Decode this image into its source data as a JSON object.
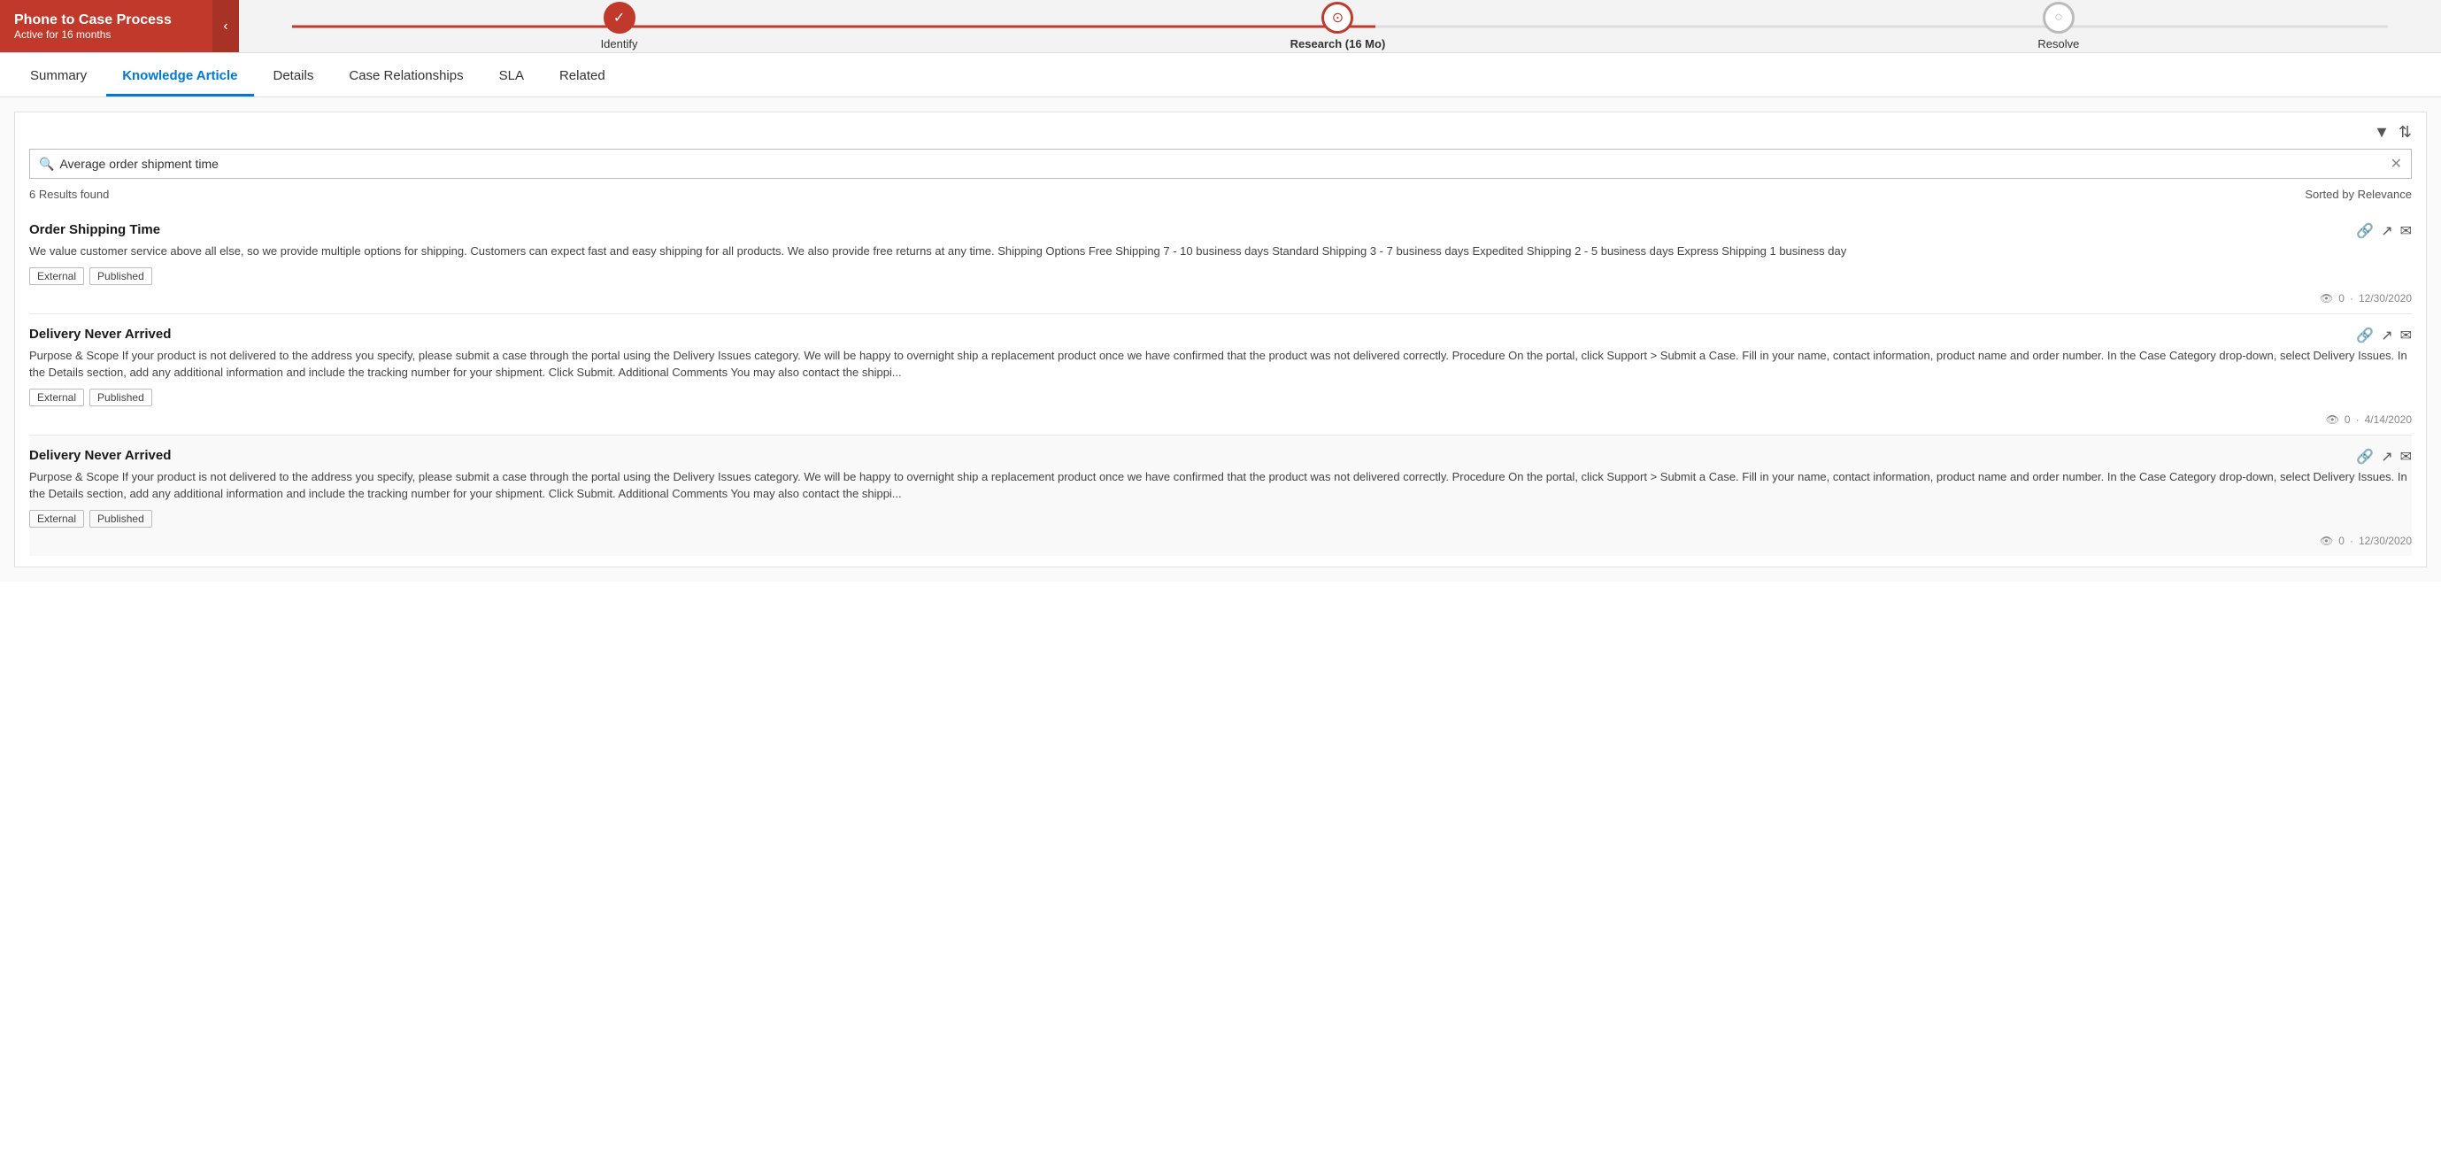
{
  "processBar": {
    "title": "Phone to Case Process",
    "subtitle": "Active for 16 months",
    "collapseIcon": "‹",
    "steps": [
      {
        "id": "identify",
        "label": "Identify",
        "state": "done"
      },
      {
        "id": "research",
        "label": "Research  (16 Mo)",
        "state": "active"
      },
      {
        "id": "resolve",
        "label": "Resolve",
        "state": "inactive"
      }
    ]
  },
  "tabs": [
    {
      "id": "summary",
      "label": "Summary",
      "active": false
    },
    {
      "id": "knowledge-article",
      "label": "Knowledge Article",
      "active": true
    },
    {
      "id": "details",
      "label": "Details",
      "active": false
    },
    {
      "id": "case-relationships",
      "label": "Case Relationships",
      "active": false
    },
    {
      "id": "sla",
      "label": "SLA",
      "active": false
    },
    {
      "id": "related",
      "label": "Related",
      "active": false
    }
  ],
  "knowledgePanel": {
    "searchPlaceholder": "Average order shipment time",
    "searchValue": "Average order shipment time",
    "clearIcon": "✕",
    "filterIcon": "▼",
    "sortIcon": "⇅",
    "resultsCount": "6 Results found",
    "sortedBy": "Sorted by Relevance",
    "articles": [
      {
        "id": "1",
        "title": "Order Shipping Time",
        "body": "We value customer service above all else, so we provide multiple options for shipping. Customers can expect fast and easy shipping for all products. We also provide free returns at any time. Shipping Options Free Shipping 7 - 10 business days Standard Shipping 3 - 7 business days Expedited Shipping 2 - 5 business days Express Shipping 1 business day",
        "tags": [
          "External",
          "Published"
        ],
        "views": "0",
        "date": "12/30/2020",
        "altBg": false
      },
      {
        "id": "2",
        "title": "Delivery Never Arrived",
        "body": "Purpose & Scope If your product is not delivered to the address you specify, please submit a case through the portal using the Delivery Issues category. We will be happy to overnight ship a replacement product once we have confirmed that the product was not delivered correctly. Procedure On the portal, click Support > Submit a Case. Fill in your name, contact information, product name and order number. In the Case Category drop-down, select Delivery Issues. In the Details section, add any additional information and include the tracking number for your shipment. Click Submit. Additional Comments You may also contact the shippi...",
        "tags": [
          "External",
          "Published"
        ],
        "views": "0",
        "date": "4/14/2020",
        "altBg": false
      },
      {
        "id": "3",
        "title": "Delivery Never Arrived",
        "body": "Purpose & Scope If your product is not delivered to the address you specify, please submit a case through the portal using the Delivery Issues category. We will be happy to overnight ship a replacement product once we have confirmed that the product was not delivered correctly. Procedure On the portal, click Support > Submit a Case. Fill in your name, contact information, product name and order number. In the Case Category drop-down, select Delivery Issues. In the Details section, add any additional information and include the tracking number for your shipment. Click Submit. Additional Comments You may also contact the shippi...",
        "tags": [
          "External",
          "Published"
        ],
        "views": "0",
        "date": "12/30/2020",
        "altBg": true
      }
    ]
  }
}
